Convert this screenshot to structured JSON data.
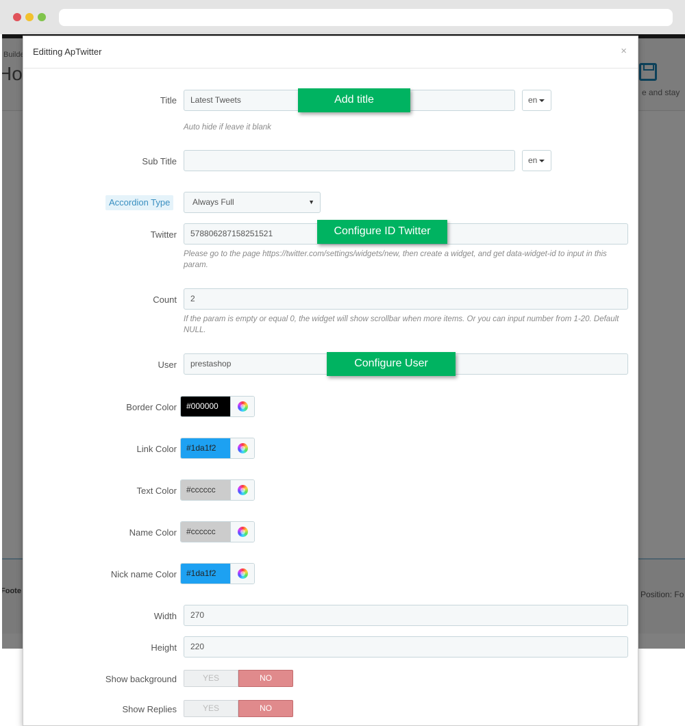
{
  "background": {
    "breadcrumb": "Builde",
    "page_title": "Hoo",
    "save_label": "e and stay",
    "footer_label": "Foote",
    "position_text": "Position: Fo"
  },
  "modal": {
    "title": "Editting ApTwitter",
    "close": "×"
  },
  "form": {
    "title": {
      "label": "Title",
      "value": "Latest Tweets",
      "lang": "en",
      "help": "Auto hide if leave it blank"
    },
    "subtitle": {
      "label": "Sub Title",
      "value": "",
      "lang": "en"
    },
    "accordion": {
      "label": "Accordion Type",
      "selected": "Always Full",
      "arrow": "▼"
    },
    "twitter": {
      "label": "Twitter",
      "value": "578806287158251521",
      "help": "Please go to the page https://twitter.com/settings/widgets/new, then create a widget, and get data-widget-id to input in this param."
    },
    "count": {
      "label": "Count",
      "value": "2",
      "help": "If the param is empty or equal 0, the widget will show scrollbar when more items. Or you can input number from 1-20. Default NULL."
    },
    "user": {
      "label": "User",
      "value": "prestashop"
    },
    "border_color": {
      "label": "Border Color",
      "value": "#000000",
      "text_color": "#ffffff"
    },
    "link_color": {
      "label": "Link Color",
      "value": "#1da1f2",
      "text_color": "#222222"
    },
    "text_color": {
      "label": "Text Color",
      "value": "#cccccc",
      "text_color": "#333333"
    },
    "name_color": {
      "label": "Name Color",
      "value": "#cccccc",
      "text_color": "#333333"
    },
    "nick_color": {
      "label": "Nick name Color",
      "value": "#1da1f2",
      "text_color": "#222222"
    },
    "width": {
      "label": "Width",
      "value": "270"
    },
    "height": {
      "label": "Height",
      "value": "220"
    },
    "show_background": {
      "label": "Show background",
      "yes": "YES",
      "no": "NO",
      "selected": "NO"
    },
    "show_replies": {
      "label": "Show Replies",
      "yes": "YES",
      "no": "NO",
      "selected": "NO"
    }
  },
  "callouts": {
    "title": "Add title",
    "twitter": "Configure ID Twitter",
    "user": "Configure User",
    "color": "#00b361"
  }
}
